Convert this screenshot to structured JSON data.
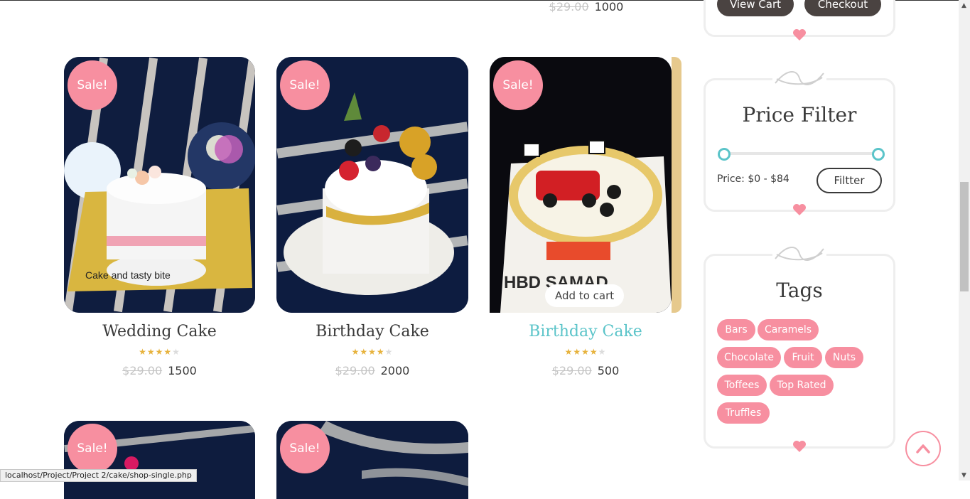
{
  "top_row": {
    "old_price": "$29.00",
    "price": "1000"
  },
  "products": [
    {
      "sale": "Sale!",
      "name": "Wedding Cake",
      "old_price": "$29.00",
      "price": "1500",
      "rating": 4,
      "image_caption": "Cake and tasty bite"
    },
    {
      "sale": "Sale!",
      "name": "Birthday Cake",
      "old_price": "$29.00",
      "price": "2000",
      "rating": 4
    },
    {
      "sale": "Sale!",
      "name": "Birthday Cake",
      "old_price": "$29.00",
      "price": "500",
      "rating": 4,
      "add_to_cart": "Add to cart",
      "image_text": "HBD SAMAD"
    }
  ],
  "bottom_products": [
    {
      "sale": "Sale!"
    },
    {
      "sale": "Sale!"
    }
  ],
  "cart_widget": {
    "view_cart": "View Cart",
    "checkout": "Checkout"
  },
  "price_filter": {
    "title": "Price Filter",
    "label": "Price:",
    "range": "$0 - $84",
    "button": "Filtter",
    "range_min_fraction": 0,
    "range_max_fraction": 1
  },
  "tags": {
    "title": "Tags",
    "items": [
      "Bars",
      "Caramels",
      "Chocolate",
      "Fruit",
      "Nuts",
      "Toffees",
      "Top Rated",
      "Truffles"
    ]
  },
  "status_url": "localhost/Project/Project 2/cake/shop-single.php",
  "colors": {
    "accent_pink": "#f78fa0",
    "accent_teal": "#5bc4c9",
    "dark_button": "#4a4341"
  }
}
